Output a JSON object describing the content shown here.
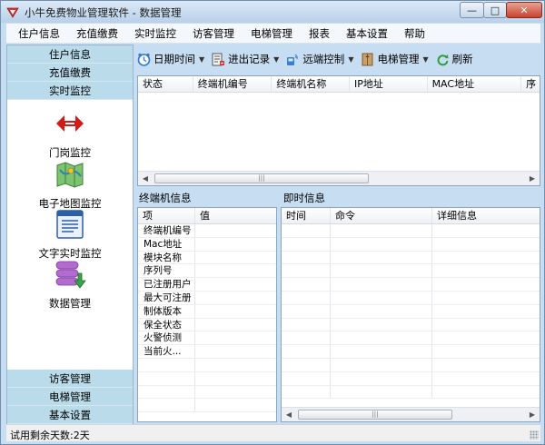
{
  "window": {
    "title": "小牛免费物业管理软件 - 数据管理",
    "min_glyph": "—",
    "max_glyph": "□",
    "close_glyph": "✕"
  },
  "menubar": {
    "items": [
      "住户信息",
      "充值缴费",
      "实时监控",
      "访客管理",
      "电梯管理",
      "报表",
      "基本设置",
      "帮助"
    ]
  },
  "leftnav": {
    "top_items": [
      "住户信息",
      "充值缴费",
      "实时监控"
    ],
    "tiles": [
      {
        "label": "门岗监控",
        "icon": "double-arrow-icon"
      },
      {
        "label": "电子地图监控",
        "icon": "map-icon"
      },
      {
        "label": "文字实时监控",
        "icon": "text-document-icon"
      },
      {
        "label": "数据管理",
        "icon": "database-icon"
      }
    ],
    "bottom_items": [
      "访客管理",
      "电梯管理",
      "基本设置"
    ]
  },
  "toolbar": {
    "buttons": [
      {
        "label": "日期时间",
        "icon": "clock-icon",
        "dropdown": true
      },
      {
        "label": "进出记录",
        "icon": "record-icon",
        "dropdown": true
      },
      {
        "label": "远端控制",
        "icon": "remote-control-icon",
        "dropdown": true
      },
      {
        "label": "电梯管理",
        "icon": "elevator-icon",
        "dropdown": true
      },
      {
        "label": "刷新",
        "icon": "refresh-icon",
        "dropdown": false
      }
    ],
    "caret": "▼"
  },
  "device_grid": {
    "columns": [
      "状态",
      "终端机编号",
      "终端机名称",
      "IP地址",
      "MAC地址",
      "序"
    ]
  },
  "terminal_info": {
    "title": "终端机信息",
    "columns": [
      "项",
      "值"
    ],
    "rows": [
      "终端机编号",
      "Mac地址",
      "模块名称",
      "序列号",
      "已注册用户",
      "最大可注册",
      "制体版本",
      "保全状态",
      "火警侦测",
      "当前火..."
    ]
  },
  "instant_info": {
    "title": "即时信息",
    "columns": [
      "时间",
      "命令",
      "详细信息"
    ]
  },
  "scroll": {
    "left": "◀",
    "right": "▶",
    "thumb": "|||"
  },
  "statusbar": {
    "text": "试用剩余天数:2天"
  },
  "colors": {
    "accent": "#b9dbea",
    "close": "#c8422d",
    "frame": "#c7ddf1"
  }
}
